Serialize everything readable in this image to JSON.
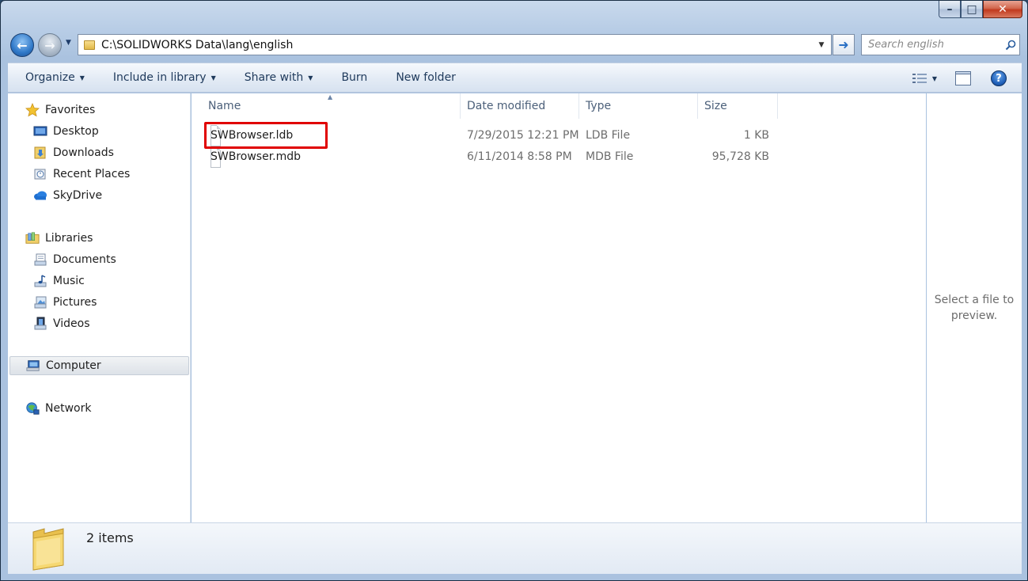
{
  "window": {
    "caption": {
      "minimize": "–",
      "maximize": "□",
      "close": "✕"
    }
  },
  "address": {
    "path": "C:\\SOLIDWORKS Data\\lang\\english",
    "search_placeholder": "Search english"
  },
  "toolbar": {
    "organize": "Organize",
    "include_in_library": "Include in library",
    "share_with": "Share with",
    "burn": "Burn",
    "new_folder": "New folder"
  },
  "sidebar": {
    "favorites": {
      "header": "Favorites",
      "items": [
        {
          "label": "Desktop",
          "icon": "desktop-icon"
        },
        {
          "label": "Downloads",
          "icon": "downloads-icon"
        },
        {
          "label": "Recent Places",
          "icon": "recent-places-icon"
        },
        {
          "label": "SkyDrive",
          "icon": "skydrive-icon"
        }
      ]
    },
    "libraries": {
      "header": "Libraries",
      "items": [
        {
          "label": "Documents",
          "icon": "documents-icon"
        },
        {
          "label": "Music",
          "icon": "music-icon"
        },
        {
          "label": "Pictures",
          "icon": "pictures-icon"
        },
        {
          "label": "Videos",
          "icon": "videos-icon"
        }
      ]
    },
    "computer": "Computer",
    "network": "Network"
  },
  "columns": {
    "name": "Name",
    "date_modified": "Date modified",
    "type": "Type",
    "size": "Size"
  },
  "files": [
    {
      "name": "SWBrowser.ldb",
      "date": "7/29/2015 12:21 PM",
      "type": "LDB File",
      "size": "1 KB"
    },
    {
      "name": "SWBrowser.mdb",
      "date": "6/11/2014 8:58 PM",
      "type": "MDB File",
      "size": "95,728 KB"
    }
  ],
  "preview": {
    "message": "Select a file to preview."
  },
  "details": {
    "item_count": "2 items"
  },
  "colors": {
    "highlight": "#e00000",
    "accent": "#2f78c8"
  }
}
